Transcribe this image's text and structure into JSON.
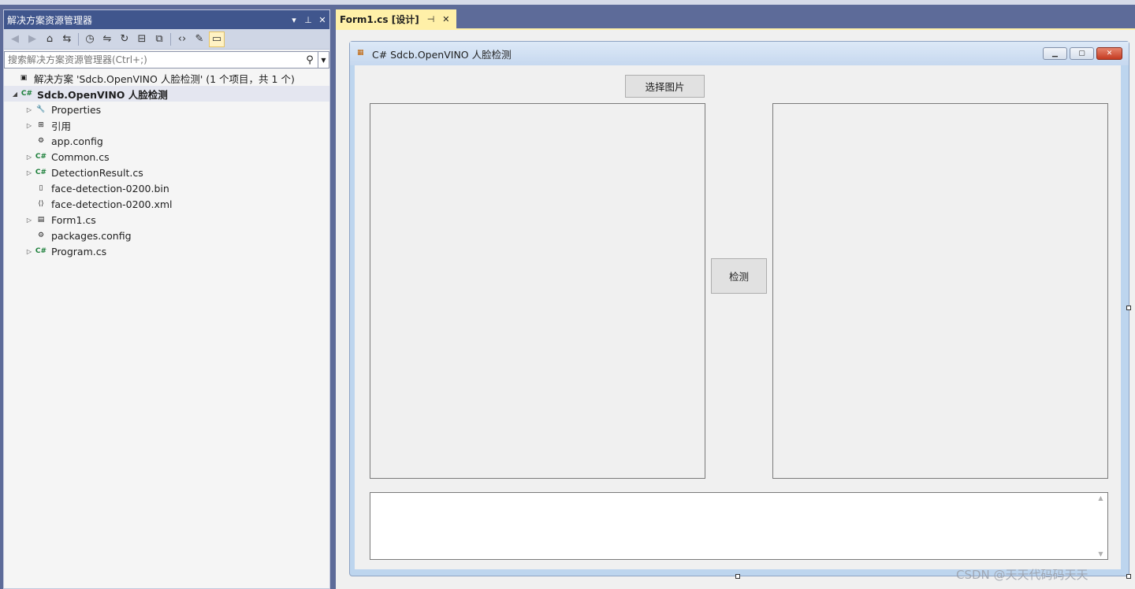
{
  "solution_explorer": {
    "title": "解决方案资源管理器",
    "search_placeholder": "搜索解决方案资源管理器(Ctrl+;)",
    "solution": "解决方案 'Sdcb.OpenVINO 人脸检测' (1 个项目，共 1 个)",
    "project": "Sdcb.OpenVINO 人脸检测",
    "items": [
      {
        "label": "Properties",
        "expandable": true,
        "icon": "wrench-icon"
      },
      {
        "label": "引用",
        "expandable": true,
        "icon": "references-icon"
      },
      {
        "label": "app.config",
        "expandable": false,
        "icon": "config-file-icon"
      },
      {
        "label": "Common.cs",
        "expandable": true,
        "icon": "csharp-file-icon"
      },
      {
        "label": "DetectionResult.cs",
        "expandable": true,
        "icon": "csharp-file-icon"
      },
      {
        "label": "face-detection-0200.bin",
        "expandable": false,
        "icon": "file-icon"
      },
      {
        "label": "face-detection-0200.xml",
        "expandable": false,
        "icon": "xml-file-icon"
      },
      {
        "label": "Form1.cs",
        "expandable": true,
        "icon": "form-file-icon"
      },
      {
        "label": "packages.config",
        "expandable": false,
        "icon": "config-file-icon"
      },
      {
        "label": "Program.cs",
        "expandable": true,
        "icon": "csharp-file-icon"
      }
    ]
  },
  "designer": {
    "tab_label": "Form1.cs [设计]",
    "form_title": "C# Sdcb.OpenVINO 人脸检测",
    "select_image_button": "选择图片",
    "detect_button": "检测"
  },
  "watermark": "CSDN @天天代码码天天",
  "colors": {
    "panel_title_bg": "#40568d",
    "tab_active_bg": "#fff0a8",
    "ide_frame": "#5d6b99"
  }
}
